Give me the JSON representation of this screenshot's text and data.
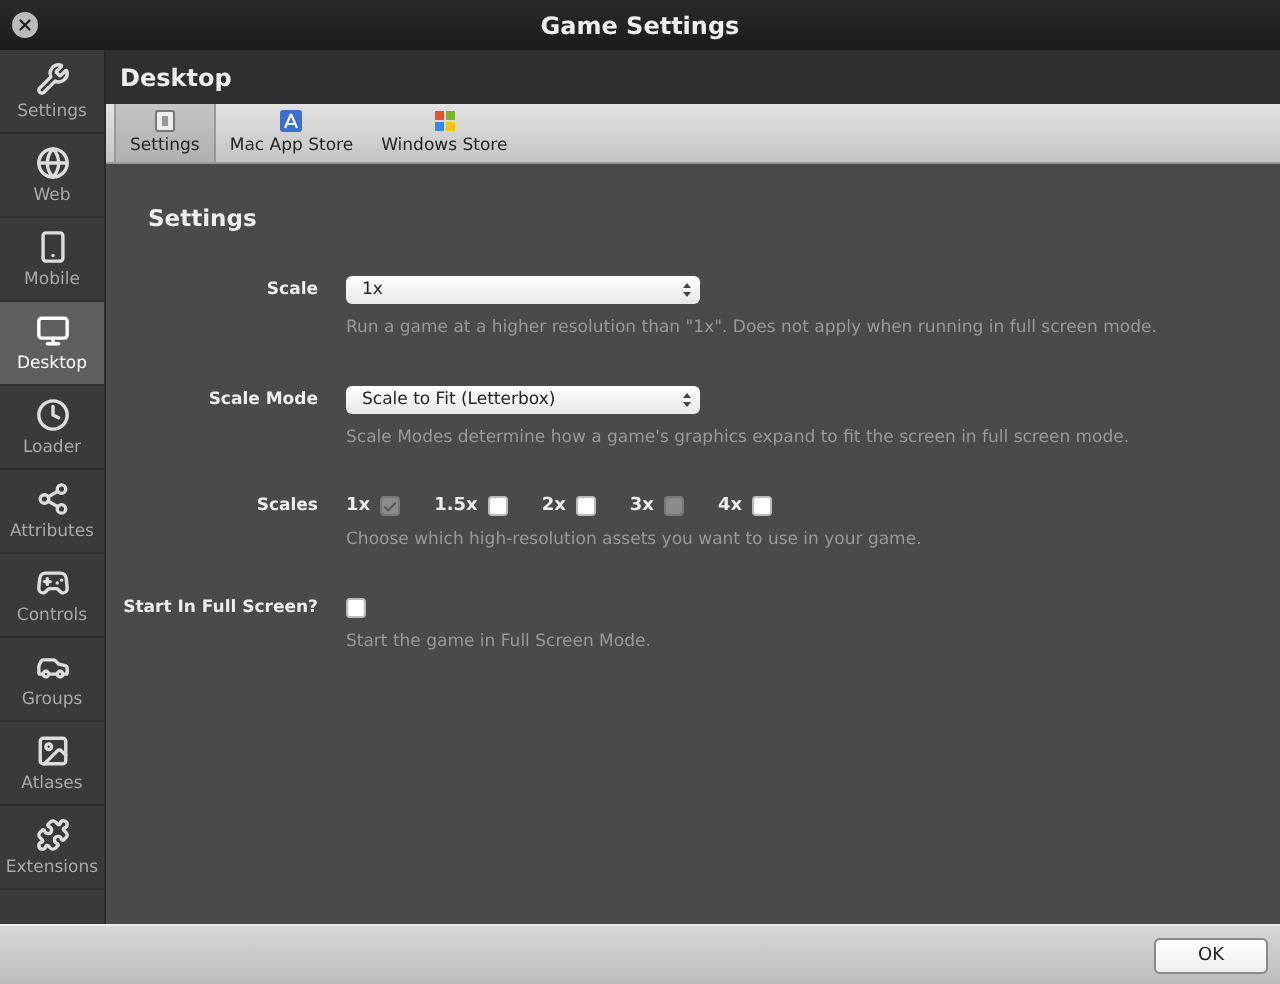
{
  "window": {
    "title": "Game Settings"
  },
  "sidebar": {
    "items": [
      {
        "label": "Settings",
        "selected": false
      },
      {
        "label": "Web",
        "selected": false
      },
      {
        "label": "Mobile",
        "selected": false
      },
      {
        "label": "Desktop",
        "selected": true
      },
      {
        "label": "Loader",
        "selected": false
      },
      {
        "label": "Attributes",
        "selected": false
      },
      {
        "label": "Controls",
        "selected": false
      },
      {
        "label": "Groups",
        "selected": false
      },
      {
        "label": "Atlases",
        "selected": false
      },
      {
        "label": "Extensions",
        "selected": false
      }
    ]
  },
  "header": {
    "title": "Desktop"
  },
  "tabs": [
    {
      "label": "Settings",
      "selected": true
    },
    {
      "label": "Mac App Store",
      "selected": false
    },
    {
      "label": "Windows Store",
      "selected": false
    }
  ],
  "section": {
    "title": "Settings"
  },
  "scale": {
    "label": "Scale",
    "value": "1x",
    "help": "Run a game at a higher resolution than \"1x\". Does not apply when running in full screen mode."
  },
  "scale_mode": {
    "label": "Scale Mode",
    "value": "Scale to Fit (Letterbox)",
    "help": "Scale Modes determine how a game's graphics expand to fit the screen in full screen mode."
  },
  "scales": {
    "label": "Scales",
    "options": [
      {
        "label": "1x",
        "checked": true,
        "disabled": true
      },
      {
        "label": "1.5x",
        "checked": false,
        "disabled": false
      },
      {
        "label": "2x",
        "checked": false,
        "disabled": false
      },
      {
        "label": "3x",
        "checked": false,
        "disabled": true
      },
      {
        "label": "4x",
        "checked": false,
        "disabled": false
      }
    ],
    "help": "Choose which high-resolution assets you want to use in your game."
  },
  "full_screen": {
    "label": "Start In Full Screen?",
    "checked": false,
    "help": "Start the game in Full Screen Mode."
  },
  "buttons": [
    "OK"
  ]
}
